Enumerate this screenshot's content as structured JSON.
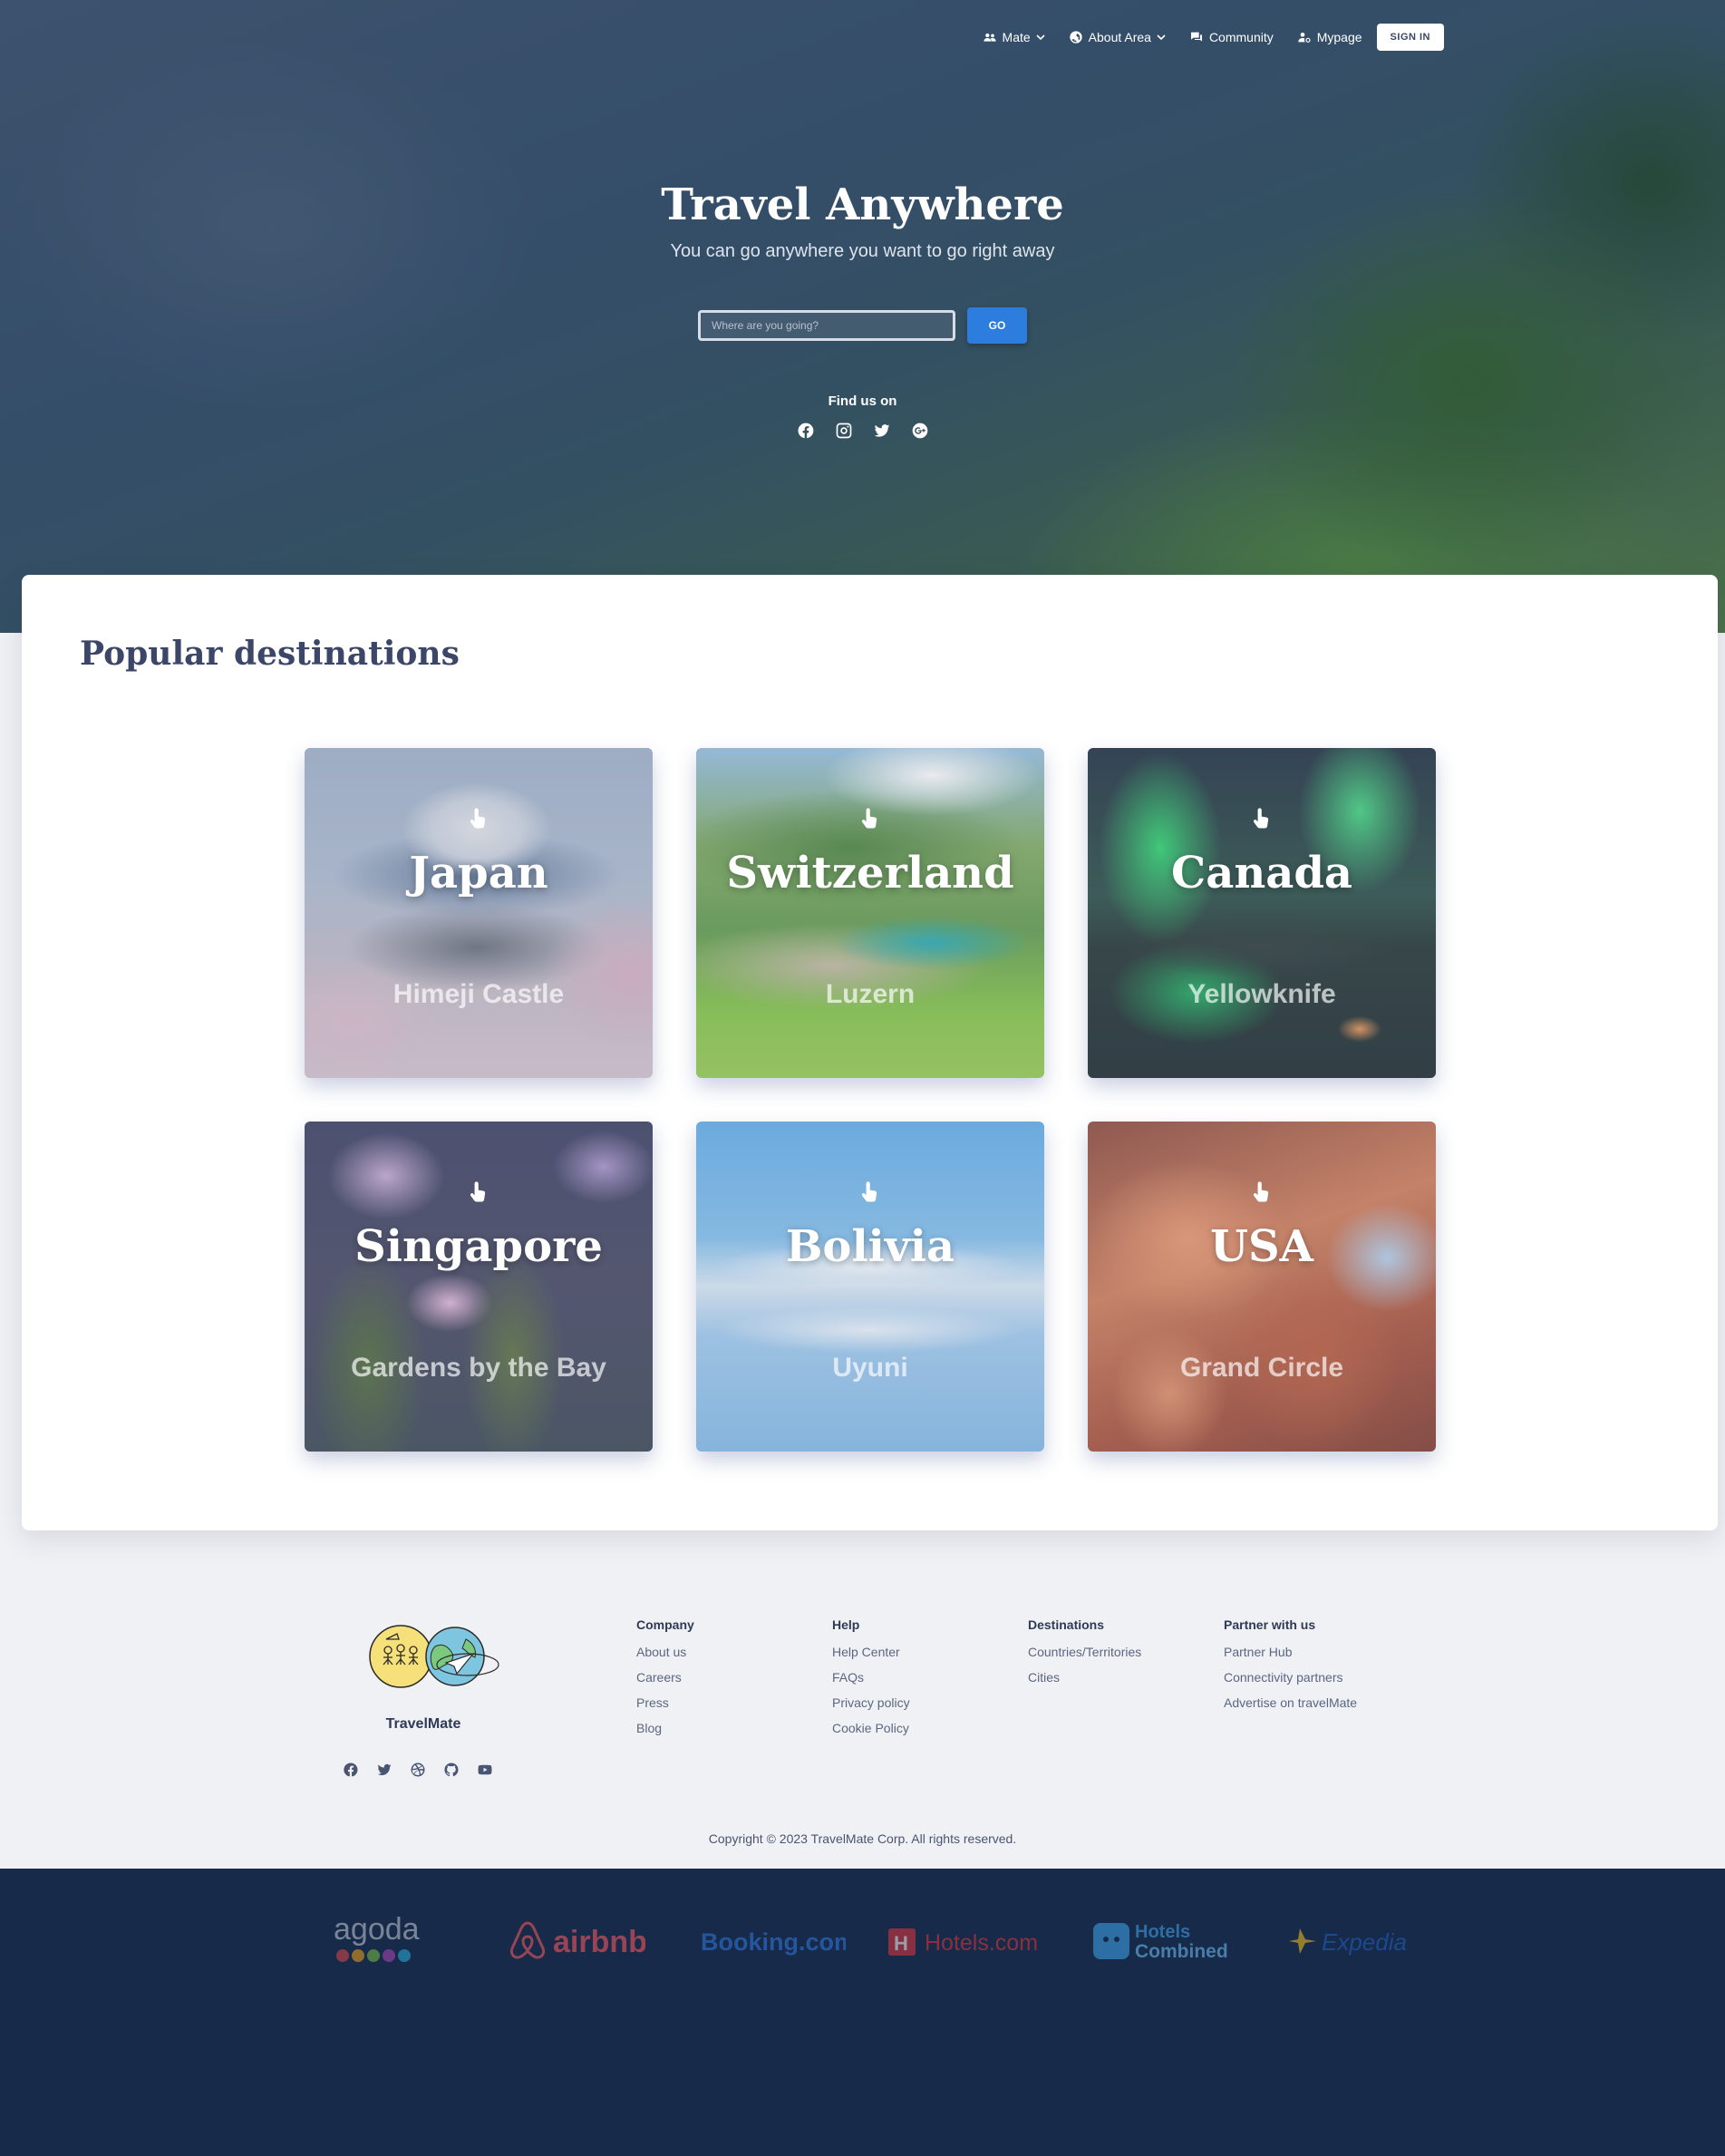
{
  "nav": {
    "items": [
      {
        "label": "Mate",
        "icon": "users-icon",
        "dropdown": true
      },
      {
        "label": "About Area",
        "icon": "globe-icon",
        "dropdown": true
      },
      {
        "label": "Community",
        "icon": "chat-icon",
        "dropdown": false
      },
      {
        "label": "Mypage",
        "icon": "user-gear-icon",
        "dropdown": false
      }
    ],
    "signin_label": "SIGN IN"
  },
  "hero": {
    "title": "Travel Anywhere",
    "subtitle": "You can go anywhere you want to go right away",
    "search_placeholder": "Where are you going?",
    "go_label": "GO",
    "find_us": "Find us on",
    "social_icons": [
      "facebook-icon",
      "instagram-icon",
      "twitter-icon",
      "google-plus-icon"
    ]
  },
  "destinations": {
    "title": "Popular destinations",
    "cards": [
      {
        "country": "Japan",
        "place": "Himeji Castle"
      },
      {
        "country": "Switzerland",
        "place": "Luzern"
      },
      {
        "country": "Canada",
        "place": "Yellowknife"
      },
      {
        "country": "Singapore",
        "place": "Gardens by the Bay"
      },
      {
        "country": "Bolivia",
        "place": "Uyuni"
      },
      {
        "country": "USA",
        "place": "Grand Circle"
      }
    ]
  },
  "footer": {
    "brand": "TravelMate",
    "social_icons": [
      "facebook-icon",
      "twitter-icon",
      "dribbble-icon",
      "github-icon",
      "youtube-icon"
    ],
    "columns": [
      {
        "heading": "Company",
        "links": [
          "About us",
          "Careers",
          "Press",
          "Blog"
        ]
      },
      {
        "heading": "Help",
        "links": [
          "Help Center",
          "FAQs",
          "Privacy policy",
          "Cookie Policy"
        ]
      },
      {
        "heading": "Destinations",
        "links": [
          "Countries/Territories",
          "Cities"
        ]
      },
      {
        "heading": "Partner with us",
        "links": [
          "Partner Hub",
          "Connectivity partners",
          "Advertise on travelMate"
        ]
      }
    ],
    "copyright": "Copyright © 2023 TravelMate Corp. All rights reserved."
  },
  "partners": {
    "logos": [
      "agoda",
      "airbnb",
      "Booking.com",
      "Hotels.com",
      "Hotels Combined",
      "Expedia"
    ]
  },
  "colors": {
    "accent": "#2d7ddf",
    "heading": "#3b4668",
    "partner_band": "#182a49",
    "page_bg": "#f0f1f5"
  }
}
